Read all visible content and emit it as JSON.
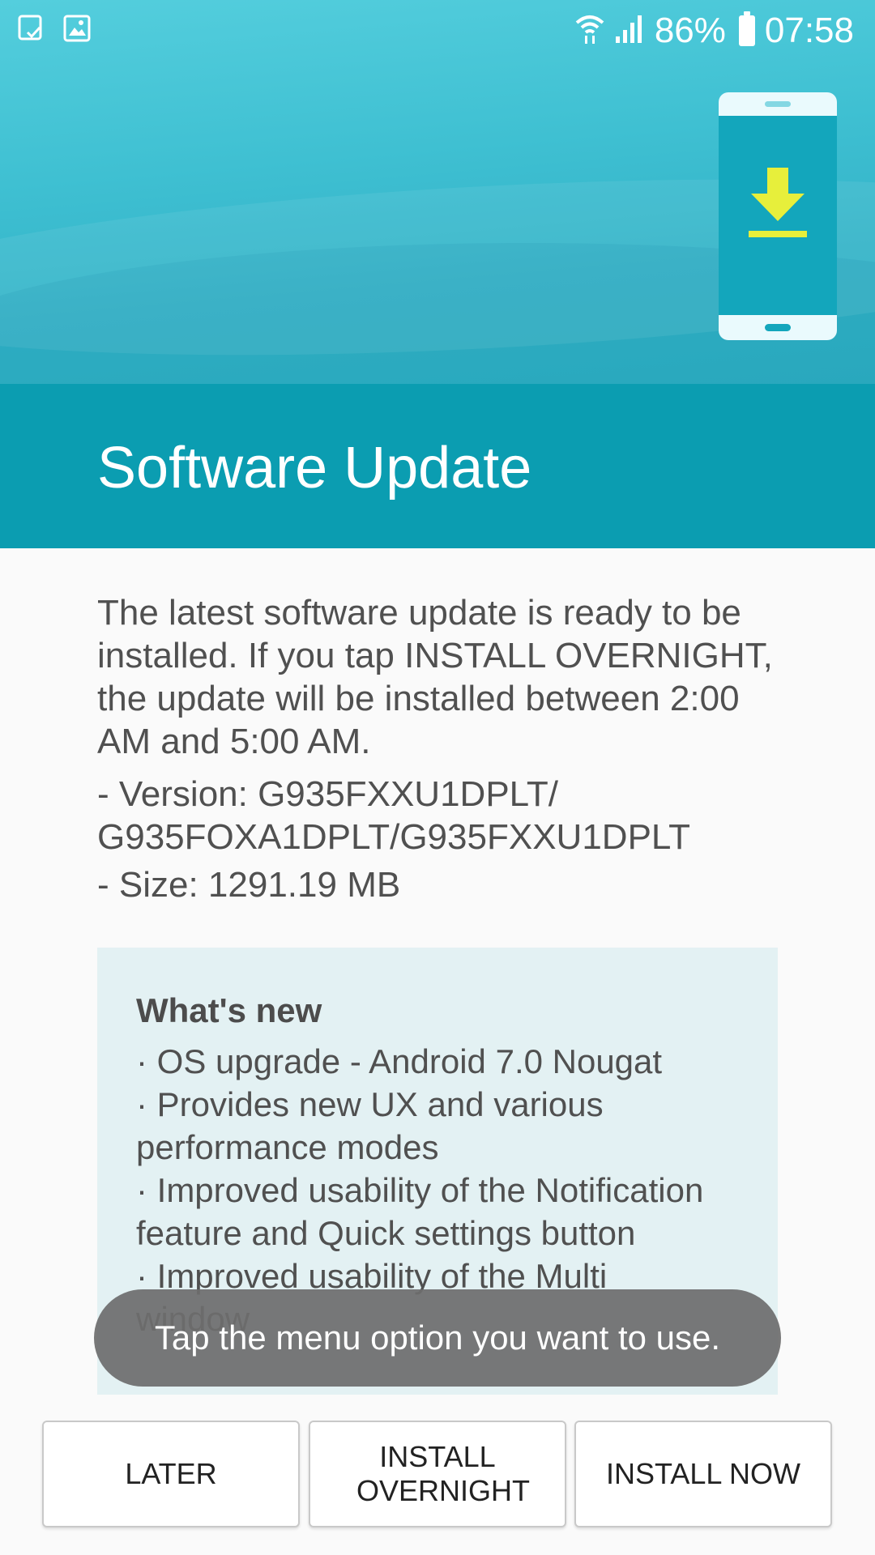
{
  "status_bar": {
    "left_icons": [
      "notification-check-icon",
      "gallery-icon"
    ],
    "wifi_icon": "wifi-icon",
    "signal_icon": "signal-icon",
    "battery_percent": "86%",
    "time": "07:58"
  },
  "illustration": {
    "icon": "download-arrow-icon",
    "accent_color": "#e7ef3b"
  },
  "header": {
    "title": "Software Update"
  },
  "content": {
    "description": "The latest software update is ready to be installed. If you tap INSTALL OVERNIGHT, the update will be installed between 2:00 AM and 5:00 AM.",
    "version": " - Version: G935FXXU1DPLT/ G935FOXA1DPLT/G935FXXU1DPLT",
    "size": " - Size: 1291.19 MB"
  },
  "whats_new": {
    "heading": "What's new",
    "items": [
      "· OS upgrade - Android 7.0 Nougat",
      "· Provides new UX and various performance modes",
      "· Improved usability of the Notification feature and Quick settings button",
      "· Improved usability of the Multi window"
    ]
  },
  "toast": {
    "message": "Tap the menu option you want to use."
  },
  "buttons": {
    "later": "LATER",
    "install_overnight": "INSTALL OVERNIGHT",
    "install_now": "INSTALL NOW"
  }
}
